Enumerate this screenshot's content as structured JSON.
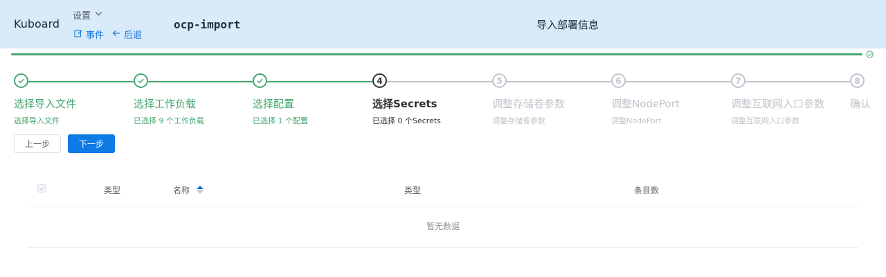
{
  "header": {
    "logo": "Kuboard",
    "settings_label": "设置",
    "events_label": "事件",
    "back_label": "后退",
    "app_name": "ocp-import",
    "page_title": "导入部署信息"
  },
  "progress": {
    "percent": 100
  },
  "steps": [
    {
      "number": "1",
      "title": "选择导入文件",
      "description": "选择导入文件",
      "status": "done"
    },
    {
      "number": "2",
      "title": "选择工作负载",
      "description": "已选择 9 个工作负载",
      "status": "done"
    },
    {
      "number": "3",
      "title": "选择配置",
      "description": "已选择 1 个配置",
      "status": "done"
    },
    {
      "number": "4",
      "title": "选择Secrets",
      "description": "已选择 0 个Secrets",
      "status": "active"
    },
    {
      "number": "5",
      "title": "调整存储卷参数",
      "description": "调整存储卷参数",
      "status": "wait"
    },
    {
      "number": "6",
      "title": "调整NodePort",
      "description": "调整NodePort",
      "status": "wait"
    },
    {
      "number": "7",
      "title": "调整互联网入口参数",
      "description": "调整互联网入口参数",
      "status": "wait"
    },
    {
      "number": "8",
      "title": "确认",
      "description": "",
      "status": "wait"
    }
  ],
  "buttons": {
    "prev": "上一步",
    "next": "下一步"
  },
  "table": {
    "columns": [
      "类型",
      "名称",
      "类型",
      "条目数"
    ],
    "empty_text": "暂无数据"
  },
  "colors": {
    "success": "#45a670",
    "primary": "#0f7be6",
    "header_bg": "#d9eafb",
    "inactive": "#c0c4cc"
  }
}
